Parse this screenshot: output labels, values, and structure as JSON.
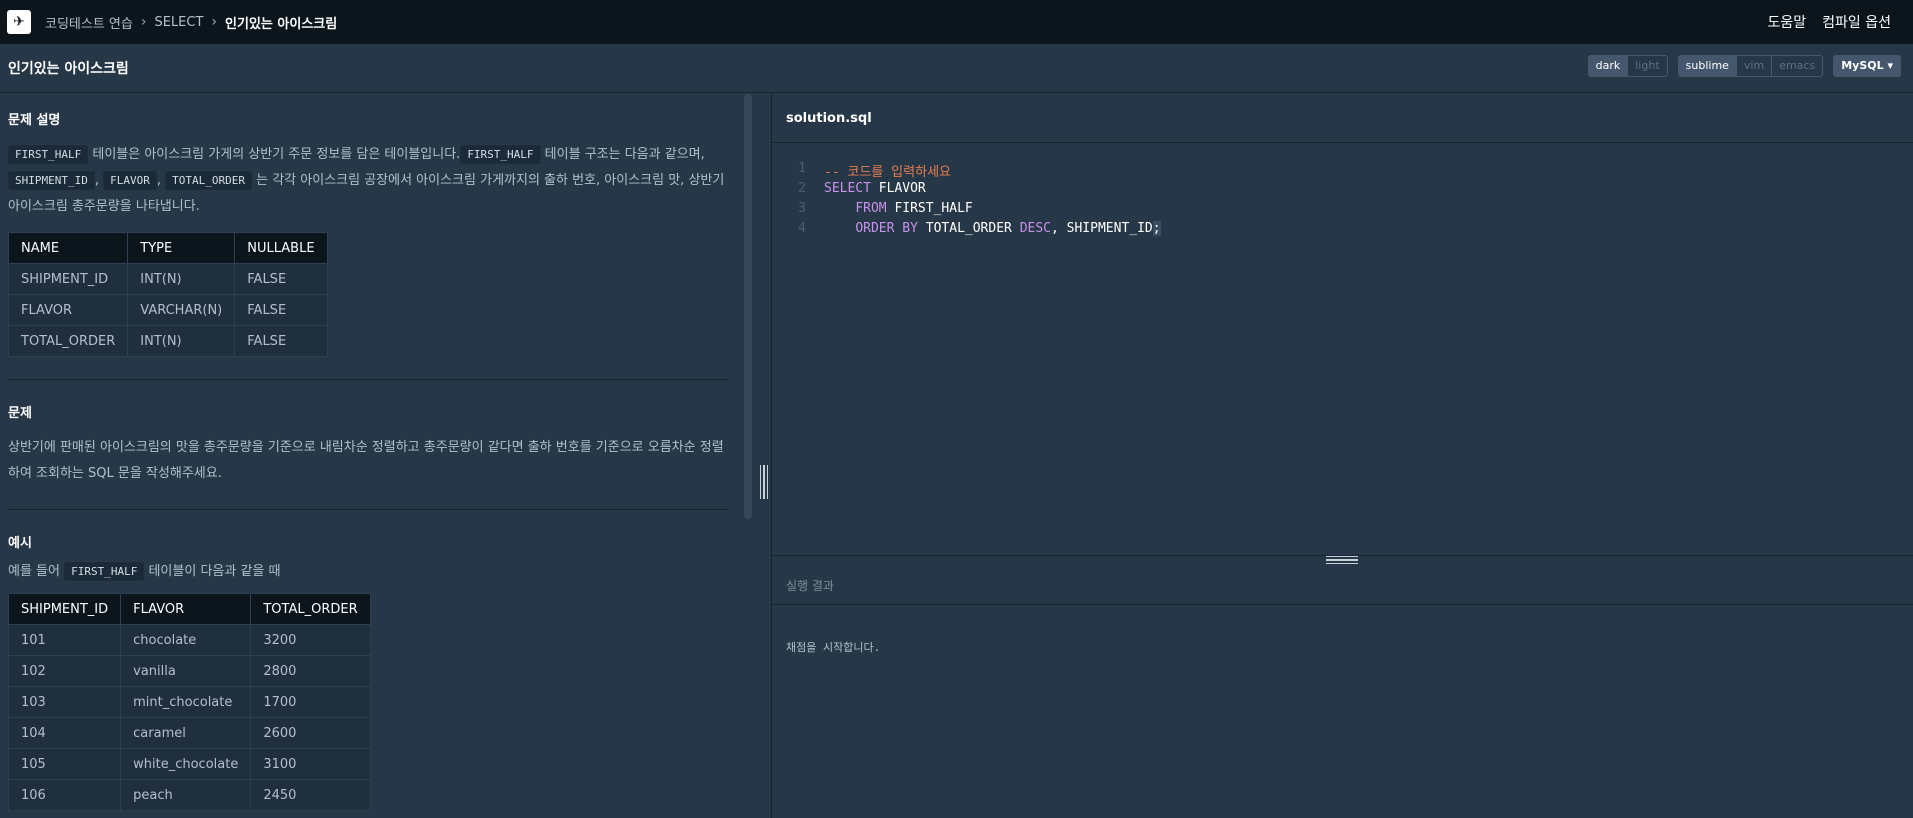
{
  "nav": {
    "breadcrumb": [
      "코딩테스트 연습",
      "SELECT",
      "인기있는 아이스크림"
    ],
    "help": "도움말",
    "compile_options": "컴파일 옵션"
  },
  "title": "인기있는 아이스크림",
  "themes": [
    "dark",
    "light"
  ],
  "active_theme": "dark",
  "keymaps": [
    "sublime",
    "vim",
    "emacs"
  ],
  "active_keymap": "sublime",
  "language": "MySQL",
  "problem": {
    "desc_heading": "문제 설명",
    "desc_parts": {
      "code1": "FIRST_HALF",
      "t1": " 테이블은 아이스크림 가게의 상반기 주문 정보를 담은 테이블입니다.",
      "code2": "FIRST_HALF",
      "t2": " 테이블 구조는 다음과 같으며, ",
      "code3": "SHIPMENT_ID",
      "t3": ", ",
      "code4": "FLAVOR",
      "t4": ", ",
      "code5": "TOTAL_ORDER",
      "t5": " 는 각각 아이스크림 공장에서 아이스크림 가게까지의 출하 번호, 아이스크림 맛, 상반기 아이스크림 총주문량을 나타냅니다."
    },
    "schema": {
      "headers": [
        "NAME",
        "TYPE",
        "NULLABLE"
      ],
      "rows": [
        [
          "SHIPMENT_ID",
          "INT(N)",
          "FALSE"
        ],
        [
          "FLAVOR",
          "VARCHAR(N)",
          "FALSE"
        ],
        [
          "TOTAL_ORDER",
          "INT(N)",
          "FALSE"
        ]
      ]
    },
    "task_heading": "문제",
    "task_text": "상반기에 판매된 아이스크림의 맛을 총주문량을 기준으로 내림차순 정렬하고 총주문량이 같다면 출하 번호를 기준으로 오름차순 정렬하여 조회하는 SQL 문을 작성해주세요.",
    "example_heading": "예시",
    "example_pre": "예를 들어 ",
    "example_code": "FIRST_HALF",
    "example_post": " 테이블이 다음과 같을 때",
    "example_table": {
      "headers": [
        "SHIPMENT_ID",
        "FLAVOR",
        "TOTAL_ORDER"
      ],
      "rows": [
        [
          "101",
          "chocolate",
          "3200"
        ],
        [
          "102",
          "vanilla",
          "2800"
        ],
        [
          "103",
          "mint_chocolate",
          "1700"
        ],
        [
          "104",
          "caramel",
          "2600"
        ],
        [
          "105",
          "white_chocolate",
          "3100"
        ],
        [
          "106",
          "peach",
          "2450"
        ]
      ]
    }
  },
  "editor": {
    "filename": "solution.sql",
    "line_numbers": [
      "1",
      "2",
      "3",
      "4"
    ],
    "comment": "-- 코드를 입력하세요",
    "kw_select": "SELECT",
    "select_rest": " FLAVOR",
    "kw_from": "FROM",
    "from_rest": " FIRST_HALF",
    "kw_order": "ORDER BY",
    "order_mid": " TOTAL_ORDER ",
    "kw_desc": "DESC",
    "order_rest": ", SHIPMENT_ID",
    "cursor_char": ";"
  },
  "result": {
    "heading": "실행 결과",
    "message": "채점을 시작합니다."
  }
}
